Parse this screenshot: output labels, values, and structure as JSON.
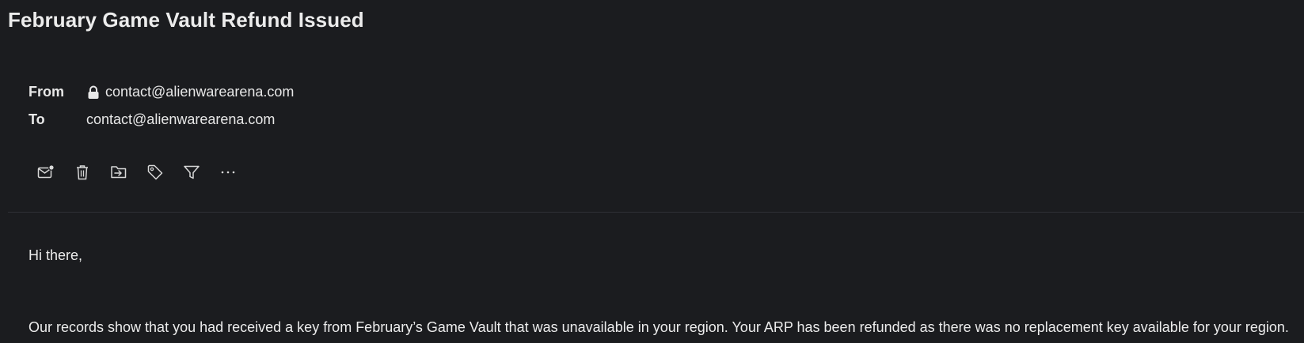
{
  "email": {
    "subject": "February Game Vault Refund Issued",
    "from_label": "From",
    "from_value": "contact@alienwarearena.com",
    "to_label": "To",
    "to_value": "contact@alienwarearena.com"
  },
  "toolbar": {
    "items": [
      {
        "name": "mark-unread",
        "icon": "envelope-dot-icon"
      },
      {
        "name": "delete",
        "icon": "trash-icon"
      },
      {
        "name": "move",
        "icon": "move-to-folder-icon"
      },
      {
        "name": "tag",
        "icon": "tag-icon"
      },
      {
        "name": "filter",
        "icon": "filter-icon"
      },
      {
        "name": "more",
        "icon": "more-horizontal-icon"
      }
    ]
  },
  "body": {
    "greeting": "Hi there,",
    "paragraph": "Our records show that you had received a key from February’s Game Vault that was unavailable in your region. Your ARP has been refunded as there was no replacement key available for your region."
  },
  "colors": {
    "background": "#1b1c1f",
    "text": "#e8e8e8",
    "divider": "#2e3035"
  }
}
